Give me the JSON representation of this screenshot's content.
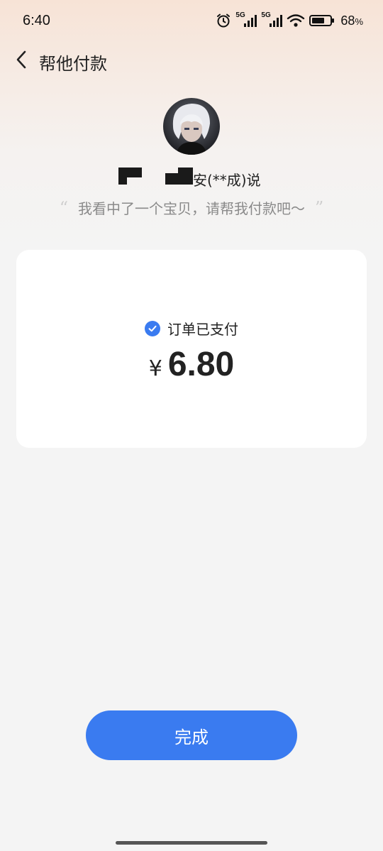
{
  "status_bar": {
    "time": "6:40",
    "battery_percent": "68",
    "battery_unit": "%",
    "network_1": "5G",
    "network_2": "5G",
    "icons": [
      "alarm-icon",
      "signal-5g-icon",
      "signal-5g-icon",
      "wifi-icon",
      "battery-icon"
    ]
  },
  "header": {
    "title": "帮他付款",
    "back_icon": "back-chevron-icon"
  },
  "profile": {
    "name_visible": "安(**成)说",
    "message": "我看中了一个宝贝，请帮我付款吧～",
    "quote_open": "“",
    "quote_close": "”"
  },
  "order": {
    "status": "订单已支付",
    "currency": "¥",
    "amount": "6.80"
  },
  "actions": {
    "done_label": "完成"
  },
  "colors": {
    "accent": "#3a7bf0",
    "background": "#f4f4f4",
    "card": "#ffffff"
  }
}
